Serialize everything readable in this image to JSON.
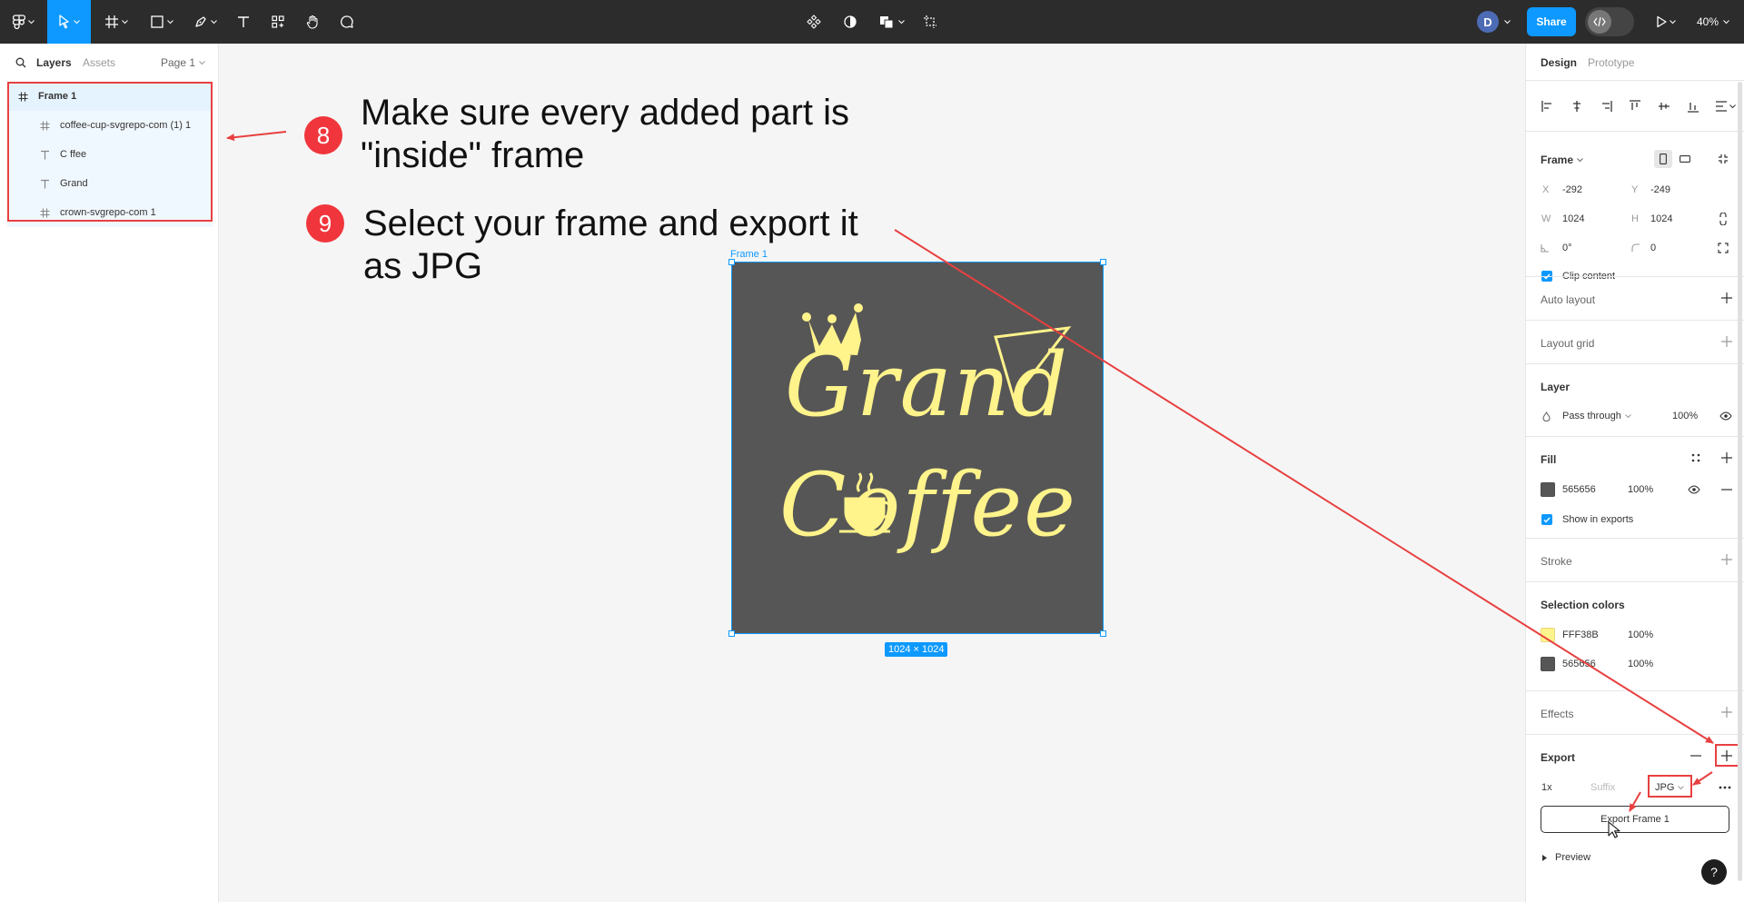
{
  "toolbar": {
    "share_label": "Share",
    "avatar_initial": "D",
    "zoom": "40%"
  },
  "left_panel": {
    "tabs": {
      "layers": "Layers",
      "assets": "Assets",
      "page": "Page 1"
    },
    "layers": [
      {
        "name": "Frame 1",
        "icon": "frame-icon"
      },
      {
        "name": "coffee-cup-svgrepo-com (1) 1",
        "icon": "frame-icon"
      },
      {
        "name": "C ffee",
        "icon": "text-icon"
      },
      {
        "name": "Grand",
        "icon": "text-icon"
      },
      {
        "name": "crown-svgrepo-com 1",
        "icon": "frame-icon"
      }
    ]
  },
  "canvas": {
    "step8": {
      "number": "8",
      "line1": "Make sure every added part is",
      "line2": "\"inside\" frame"
    },
    "step9": {
      "number": "9",
      "line1": "Select your frame and export it",
      "line2": "as JPG"
    },
    "frame_label": "Frame 1",
    "frame_size_label": "1024 × 1024",
    "logo": {
      "line1": "Grand",
      "line2": "Coffee",
      "color": "#FFF38B",
      "background": "#565656"
    }
  },
  "right_panel": {
    "tabs": {
      "design": "Design",
      "prototype": "Prototype"
    },
    "frame": {
      "title": "Frame",
      "x_label": "X",
      "x": "-292",
      "y_label": "Y",
      "y": "-249",
      "w_label": "W",
      "w": "1024",
      "h_label": "H",
      "h": "1024",
      "rotation": "0°",
      "radius": "0",
      "clip_content": "Clip content"
    },
    "auto_layout": "Auto layout",
    "layout_grid": "Layout grid",
    "layer": {
      "title": "Layer",
      "blend": "Pass through",
      "opacity": "100%"
    },
    "fill": {
      "title": "Fill",
      "hex": "565656",
      "opacity": "100%",
      "show_in_exports": "Show in exports"
    },
    "stroke": "Stroke",
    "selection_colors": {
      "title": "Selection colors",
      "items": [
        {
          "hex": "FFF38B",
          "opacity": "100%",
          "color": "#FFF38B"
        },
        {
          "hex": "565656",
          "opacity": "100%",
          "color": "#565656"
        }
      ]
    },
    "effects": "Effects",
    "export": {
      "title": "Export",
      "scale": "1x",
      "suffix_placeholder": "Suffix",
      "format": "JPG",
      "button": "Export Frame 1",
      "preview": "Preview"
    }
  },
  "help": "?",
  "colors": {
    "accent": "#0d99ff",
    "annotation_red": "#e84040"
  }
}
